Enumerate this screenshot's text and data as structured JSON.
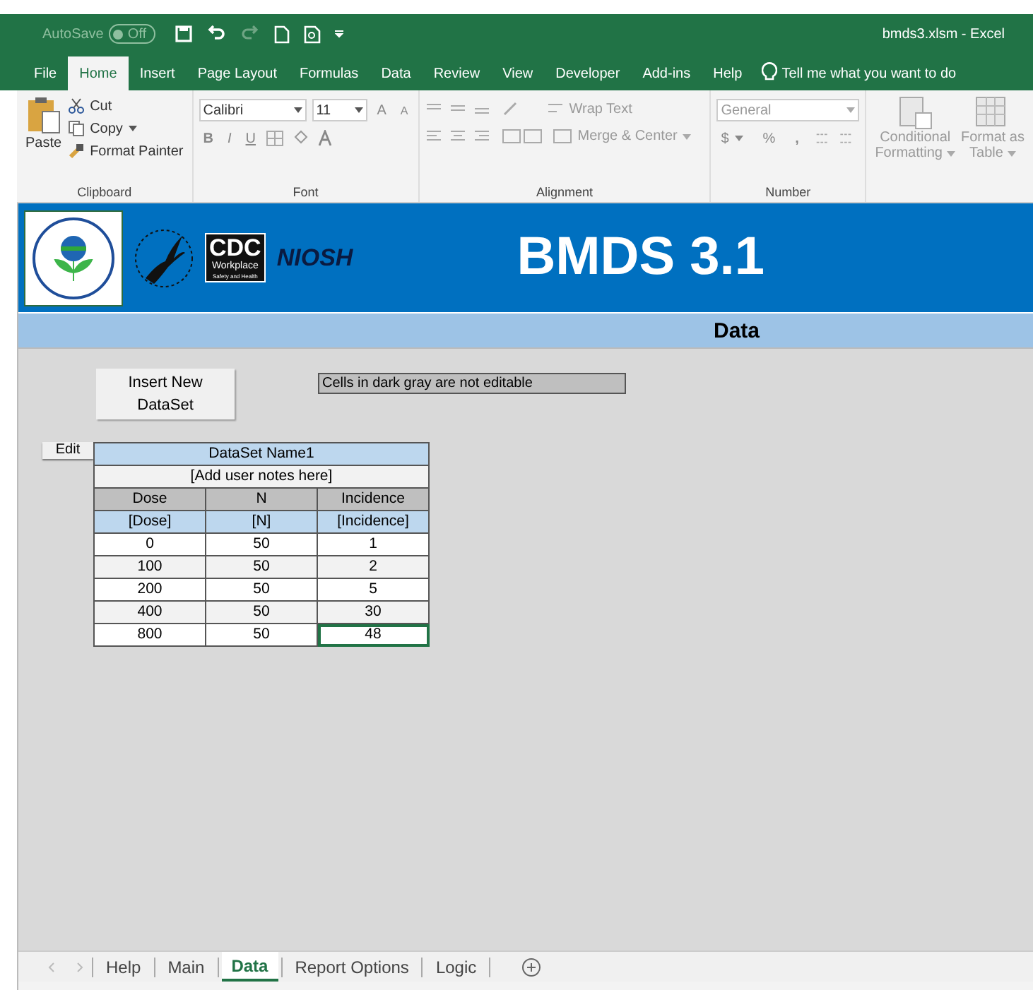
{
  "window": {
    "autosave_label": "AutoSave",
    "autosave_state": "Off",
    "title": "bmds3.xlsm  -  Excel"
  },
  "menu_tabs": [
    {
      "label": "File",
      "selected": false
    },
    {
      "label": "Home",
      "selected": true
    },
    {
      "label": "Insert",
      "selected": false
    },
    {
      "label": "Page Layout",
      "selected": false
    },
    {
      "label": "Formulas",
      "selected": false
    },
    {
      "label": "Data",
      "selected": false
    },
    {
      "label": "Review",
      "selected": false
    },
    {
      "label": "View",
      "selected": false
    },
    {
      "label": "Developer",
      "selected": false
    },
    {
      "label": "Add-ins",
      "selected": false
    },
    {
      "label": "Help",
      "selected": false
    }
  ],
  "tell_me": "Tell me what you want to do",
  "ribbon": {
    "clipboard": {
      "paste": "Paste",
      "cut": "Cut",
      "copy": "Copy",
      "format_painter": "Format Painter",
      "label": "Clipboard"
    },
    "font": {
      "family": "Calibri",
      "size": "11",
      "grow": "A",
      "shrink": "A",
      "bold": "B",
      "italic": "I",
      "underline": "U",
      "label": "Font"
    },
    "alignment": {
      "wrap": "Wrap Text",
      "merge": "Merge & Center",
      "label": "Alignment"
    },
    "number": {
      "format": "General",
      "currency": "$",
      "percent": "%",
      "comma": ",",
      "label": "Number"
    },
    "styles": {
      "conditional": "Conditional",
      "conditional_2": "Formatting",
      "format_table": "Format as",
      "format_table_2": "Table"
    }
  },
  "banner": {
    "cdc": "CDC",
    "cdc_sub": "Workplace",
    "cdc_sub_2": "Safety and Health",
    "niosh": "NIOSH",
    "title": "BMDS 3.1"
  },
  "section_title": "Data",
  "insert_button": "Insert New DataSet",
  "note": "Cells in dark gray are not editable",
  "edit_button": "Edit",
  "dataset": {
    "name": "DataSet Name1",
    "notes": "[Add user notes here]",
    "columns": [
      "Dose",
      "N",
      "Incidence"
    ],
    "units": [
      "[Dose]",
      "[N]",
      "[Incidence]"
    ],
    "rows": [
      {
        "cells": [
          {
            "text": "0",
            "selected": false
          },
          {
            "text": "50",
            "selected": false
          },
          {
            "text": "1",
            "selected": false
          }
        ]
      },
      {
        "cells": [
          {
            "text": "100",
            "selected": false
          },
          {
            "text": "50",
            "selected": false
          },
          {
            "text": "2",
            "selected": false
          }
        ]
      },
      {
        "cells": [
          {
            "text": "200",
            "selected": false
          },
          {
            "text": "50",
            "selected": false
          },
          {
            "text": "5",
            "selected": false
          }
        ]
      },
      {
        "cells": [
          {
            "text": "400",
            "selected": false
          },
          {
            "text": "50",
            "selected": false
          },
          {
            "text": "30",
            "selected": false
          }
        ]
      },
      {
        "cells": [
          {
            "text": "800",
            "selected": false
          },
          {
            "text": "50",
            "selected": false
          },
          {
            "text": "48",
            "selected": true
          }
        ]
      }
    ]
  },
  "sheet_tabs": [
    {
      "label": "Help",
      "selected": false
    },
    {
      "label": "Main",
      "selected": false
    },
    {
      "label": "Data",
      "selected": true
    },
    {
      "label": "Report Options",
      "selected": false
    },
    {
      "label": "Logic",
      "selected": false
    }
  ]
}
